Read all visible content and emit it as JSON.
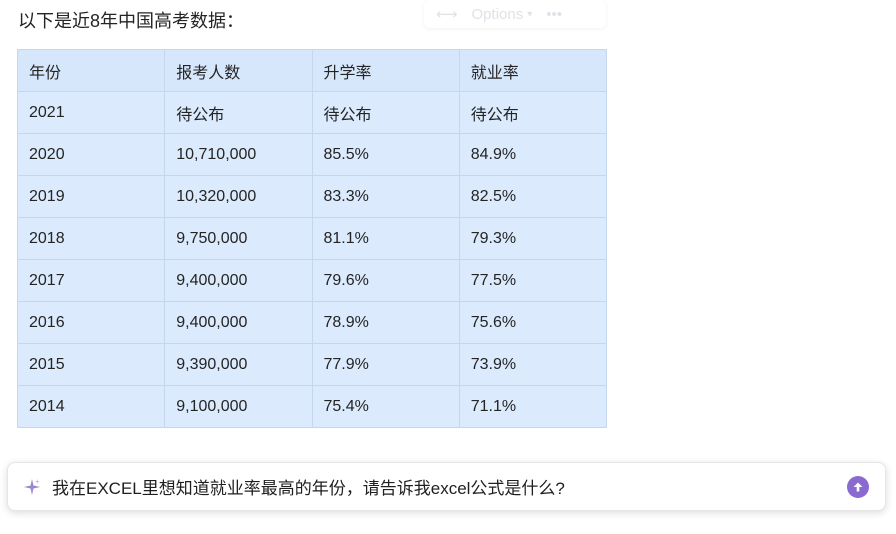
{
  "intro_text": "以下是近8年中国高考数据：",
  "toolbar": {
    "options_label": "Options",
    "more_label": "•••"
  },
  "table": {
    "headers": [
      "年份",
      "报考人数",
      "升学率",
      "就业率"
    ],
    "rows": [
      [
        "2021",
        "待公布",
        "待公布",
        "待公布"
      ],
      [
        "2020",
        "10,710,000",
        "85.5%",
        "84.9%"
      ],
      [
        "2019",
        "10,320,000",
        "83.3%",
        "82.5%"
      ],
      [
        "2018",
        "9,750,000",
        "81.1%",
        "79.3%"
      ],
      [
        "2017",
        "9,400,000",
        "79.6%",
        "77.5%"
      ],
      [
        "2016",
        "9,400,000",
        "78.9%",
        "75.6%"
      ],
      [
        "2015",
        "9,390,000",
        "77.9%",
        "73.9%"
      ],
      [
        "2014",
        "9,100,000",
        "75.4%",
        "71.1%"
      ]
    ]
  },
  "prompt": {
    "text": "我在EXCEL里想知道就业率最高的年份，请告诉我excel公式是什么?",
    "icon": "sparkle-icon",
    "send_icon": "arrow-up-icon"
  },
  "colors": {
    "table_bg": "#dbeafc",
    "table_border": "#c3d7ef",
    "send_button": "#8a6ad0",
    "sparkle": "#9b86d6"
  }
}
